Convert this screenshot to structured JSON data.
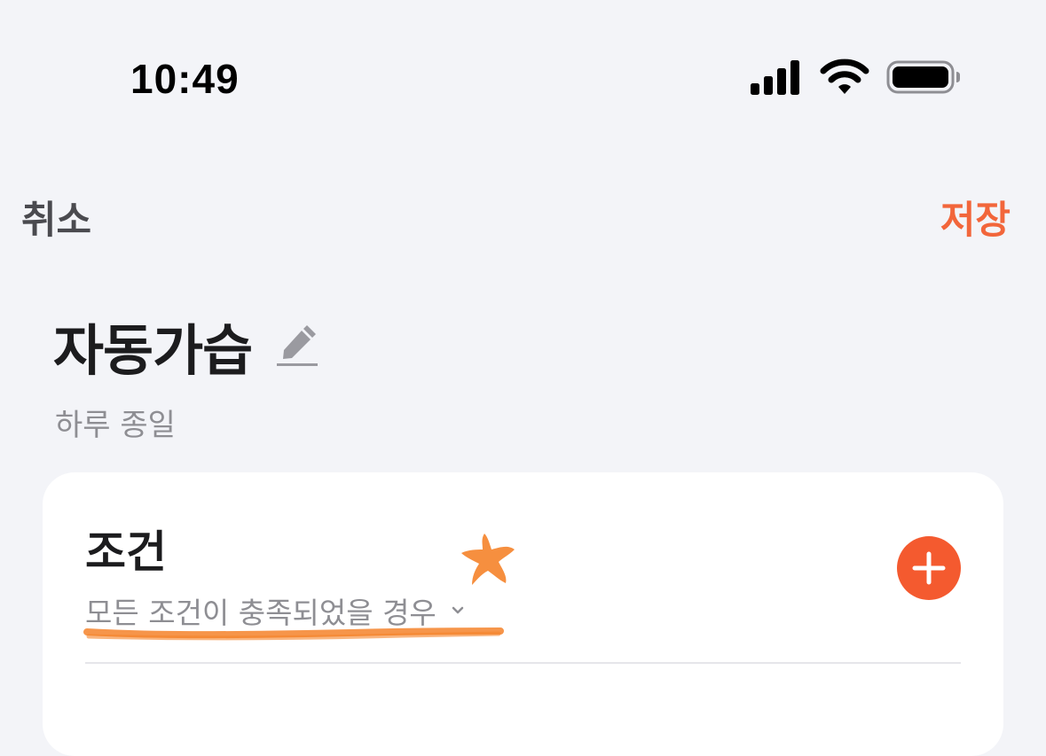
{
  "status_bar": {
    "time": "10:49",
    "icons": [
      "signal-icon",
      "wifi-icon",
      "battery-icon"
    ]
  },
  "nav": {
    "cancel_label": "취소",
    "save_label": "저장"
  },
  "header": {
    "title": "자동가습",
    "edit_icon": "pencil-icon",
    "subtitle": "하루 종일"
  },
  "condition_card": {
    "title": "조건",
    "mode_label": "모든 조건이 충족되었을 경우",
    "mode_icon": "chevron-down-icon",
    "add_icon": "plus-icon"
  },
  "colors": {
    "background": "#F3F4F8",
    "accent": "#F2663B",
    "add_button": "#F45A2F",
    "annotation": "#F5832A"
  }
}
